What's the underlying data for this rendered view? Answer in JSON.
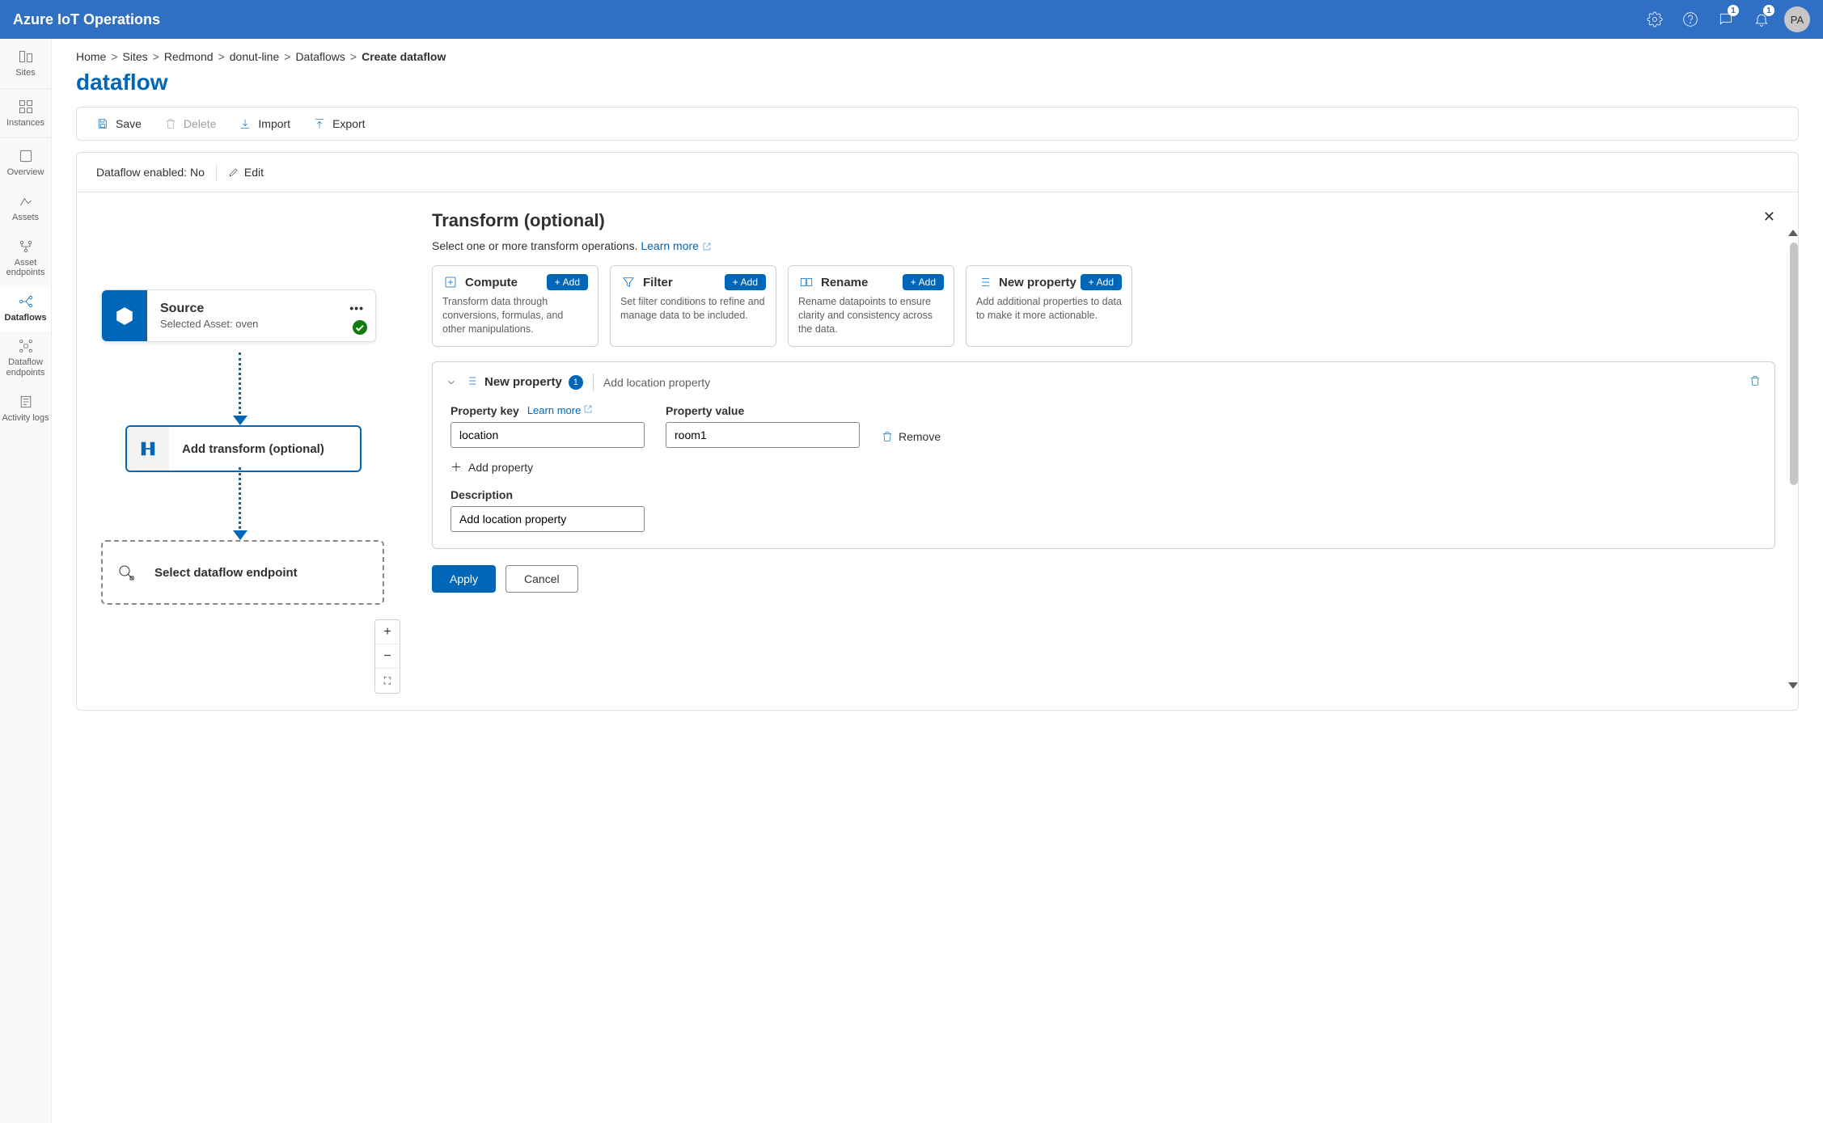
{
  "app": {
    "title": "Azure IoT Operations"
  },
  "topbar": {
    "feedback_badge": "1",
    "notifications_badge": "1",
    "avatar_initials": "PA"
  },
  "nav": {
    "sites": "Sites",
    "instances": "Instances",
    "overview": "Overview",
    "assets": "Assets",
    "asset_endpoints": "Asset endpoints",
    "dataflows": "Dataflows",
    "dataflow_endpoints": "Dataflow endpoints",
    "activity_logs": "Activity logs"
  },
  "breadcrumb": {
    "home": "Home",
    "sites": "Sites",
    "site": "Redmond",
    "instance": "donut-line",
    "dataflows": "Dataflows",
    "current": "Create dataflow"
  },
  "page": {
    "title": "dataflow"
  },
  "toolbar": {
    "save": "Save",
    "delete": "Delete",
    "import": "Import",
    "export": "Export"
  },
  "status": {
    "enabled_label": "Dataflow enabled: No",
    "edit": "Edit"
  },
  "nodes": {
    "source_title": "Source",
    "source_subtitle": "Selected Asset: oven",
    "transform_label": "Add transform (optional)",
    "endpoint_label": "Select dataflow endpoint"
  },
  "zoom": {
    "in": "+",
    "out": "−",
    "fit": "⛶"
  },
  "transform_panel": {
    "title": "Transform (optional)",
    "subtitle_prefix": "Select one or more transform operations. ",
    "learn_more": "Learn more",
    "ops": {
      "compute": {
        "name": "Compute",
        "desc": "Transform data through conversions, formulas, and other manipulations.",
        "add": "Add"
      },
      "filter": {
        "name": "Filter",
        "desc": "Set filter conditions to refine and manage data to be included.",
        "add": "Add"
      },
      "rename": {
        "name": "Rename",
        "desc": "Rename datapoints to ensure clarity and consistency across the data.",
        "add": "Add"
      },
      "new_property": {
        "name": "New property",
        "desc": "Add additional properties to data to make it more actionable.",
        "add": "Add"
      }
    },
    "block": {
      "name": "New property",
      "count": "1",
      "summary": "Add location property",
      "prop_key_label": "Property key",
      "prop_key_value": "location",
      "prop_val_label": "Property value",
      "prop_val_value": "room1",
      "learn_more": "Learn more",
      "remove": "Remove",
      "add_property": "Add property",
      "desc_label": "Description",
      "desc_value": "Add location property"
    },
    "apply": "Apply",
    "cancel": "Cancel"
  }
}
